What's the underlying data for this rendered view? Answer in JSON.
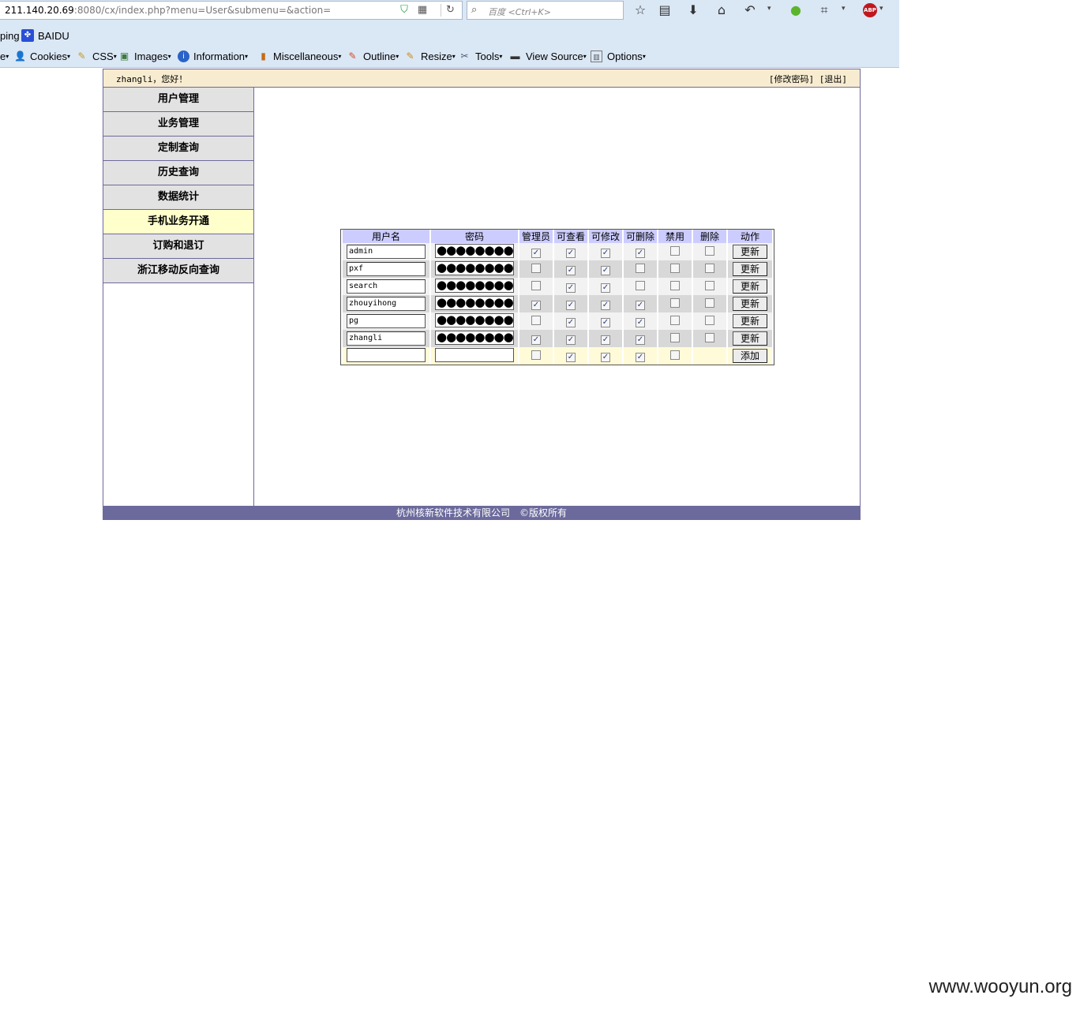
{
  "browser": {
    "url_host": "211.140.20.69",
    "url_rest": ":8080/cx/index.php?menu=User&submenu=&action=",
    "search_placeholder": "百度 <Ctrl+K>",
    "abp_label": "ABP",
    "bookmarks": [
      "ping",
      "BAIDU"
    ],
    "dev_toolbar": [
      {
        "label": "e",
        "icon": "unknown-icon"
      },
      {
        "label": "Cookies",
        "icon": "cookie-icon"
      },
      {
        "label": "CSS",
        "icon": "pencil-icon"
      },
      {
        "label": "Images",
        "icon": "image-icon"
      },
      {
        "label": "Information",
        "icon": "info-icon"
      },
      {
        "label": "Miscellaneous",
        "icon": "book-icon"
      },
      {
        "label": "Outline",
        "icon": "outline-pencil-icon"
      },
      {
        "label": "Resize",
        "icon": "ruler-icon"
      },
      {
        "label": "Tools",
        "icon": "tools-icon"
      },
      {
        "label": "View Source",
        "icon": "monitor-icon"
      },
      {
        "label": "Options",
        "icon": "options-icon"
      }
    ]
  },
  "header": {
    "greeting": "zhangli，您好！",
    "change_password": "[修改密码]",
    "logout": "[退出]"
  },
  "sidebar": {
    "items": [
      {
        "label": "用户管理",
        "active": false
      },
      {
        "label": "业务管理",
        "active": false
      },
      {
        "label": "定制查询",
        "active": false
      },
      {
        "label": "历史查询",
        "active": false
      },
      {
        "label": "数据统计",
        "active": false
      },
      {
        "label": "手机业务开通",
        "active": true
      },
      {
        "label": "订购和退订",
        "active": false
      },
      {
        "label": "浙江移动反向查询",
        "active": false
      }
    ]
  },
  "user_table": {
    "columns": [
      "用户名",
      "密码",
      "管理员",
      "可查看",
      "可修改",
      "可删除",
      "禁用",
      "删除",
      "动作"
    ],
    "password_mask": "●●●●●●●●",
    "update_label": "更新",
    "add_label": "添加",
    "check_mark": "✓",
    "rows": [
      {
        "username": "admin",
        "admin": true,
        "view": true,
        "edit": true,
        "delete_perm": true,
        "disabled": false,
        "remove": false
      },
      {
        "username": "pxf",
        "admin": false,
        "view": true,
        "edit": true,
        "delete_perm": false,
        "disabled": false,
        "remove": false
      },
      {
        "username": "search",
        "admin": false,
        "view": true,
        "edit": true,
        "delete_perm": false,
        "disabled": false,
        "remove": false
      },
      {
        "username": "zhouyihong",
        "admin": true,
        "view": true,
        "edit": true,
        "delete_perm": true,
        "disabled": false,
        "remove": false
      },
      {
        "username": "pg",
        "admin": false,
        "view": true,
        "edit": true,
        "delete_perm": true,
        "disabled": false,
        "remove": false
      },
      {
        "username": "zhangli",
        "admin": true,
        "view": true,
        "edit": true,
        "delete_perm": true,
        "disabled": false,
        "remove": false
      }
    ],
    "new_row": {
      "admin": false,
      "view": true,
      "edit": true,
      "delete_perm": true,
      "disabled": false
    }
  },
  "footer": {
    "text": "杭州核新软件技术有限公司　©版权所有"
  },
  "watermark": "www.wooyun.org"
}
